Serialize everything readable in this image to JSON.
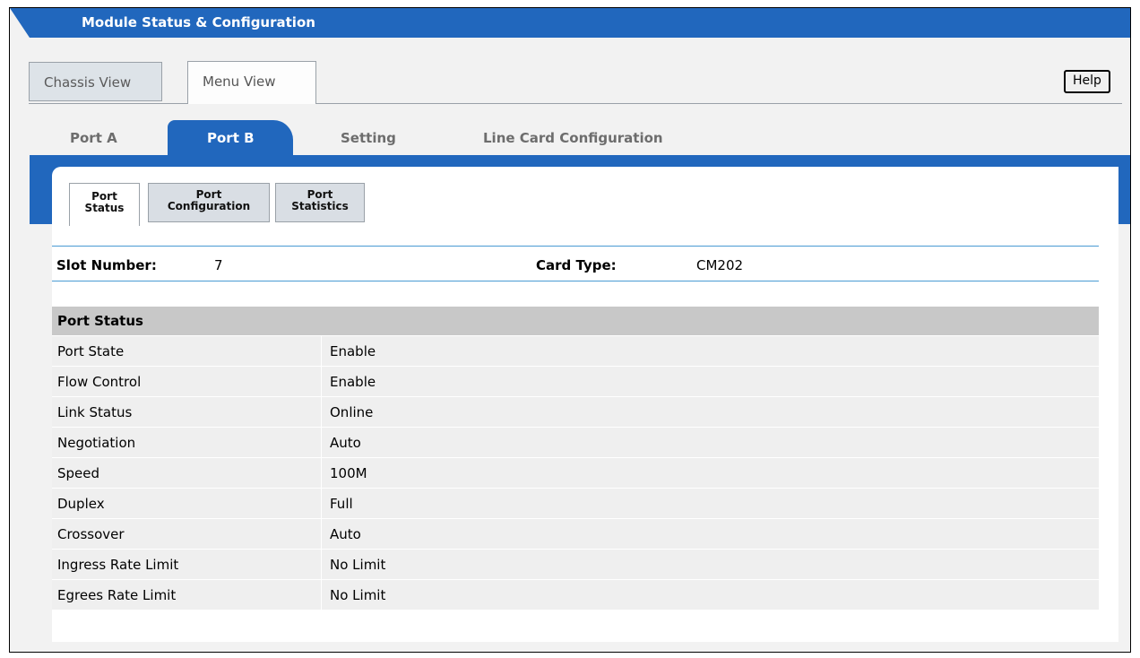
{
  "window": {
    "title": "Module Status & Configuration"
  },
  "view_tabs": {
    "chassis": "Chassis View",
    "menu": "Menu View",
    "selected": "Menu View"
  },
  "help_label": "Help",
  "port_tabs": [
    {
      "label": "Port A"
    },
    {
      "label": "Port B",
      "selected": true
    },
    {
      "label": "Setting"
    },
    {
      "label": "Line Card Configuration"
    }
  ],
  "sub_tabs": [
    {
      "line1": "Port",
      "line2": "Status",
      "selected": true
    },
    {
      "line1": "Port",
      "line2": "Configuration"
    },
    {
      "line1": "Port",
      "line2": "Statistics"
    }
  ],
  "slot": {
    "label": "Slot Number:",
    "value": "7"
  },
  "card": {
    "label": "Card Type:",
    "value": "CM202"
  },
  "port_status": {
    "header": "Port Status",
    "rows": [
      {
        "label": "Port State",
        "value": "Enable"
      },
      {
        "label": "Flow Control",
        "value": "Enable"
      },
      {
        "label": "Link Status",
        "value": "Online"
      },
      {
        "label": "Negotiation",
        "value": "Auto"
      },
      {
        "label": "Speed",
        "value": "100M"
      },
      {
        "label": "Duplex",
        "value": "Full"
      },
      {
        "label": "Crossover",
        "value": "Auto"
      },
      {
        "label": "Ingress Rate Limit",
        "value": "No Limit"
      },
      {
        "label": "Egrees Rate Limit",
        "value": "No Limit"
      }
    ]
  },
  "colors": {
    "accent_blue": "#2167bd",
    "rule_blue": "#4a9bd4",
    "header_gray": "#c8c8c8",
    "row_gray": "#efefef"
  }
}
